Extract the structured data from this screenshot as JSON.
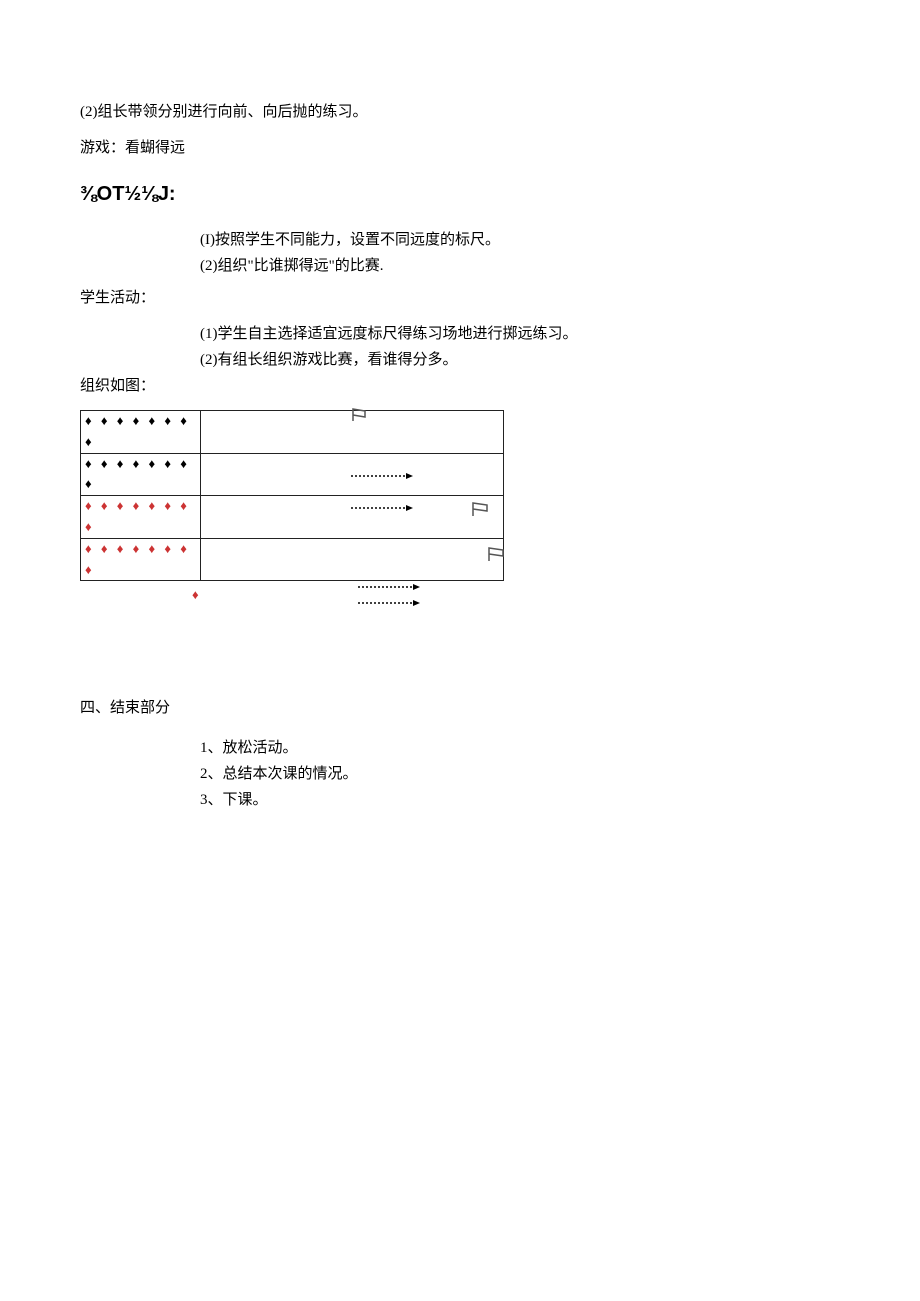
{
  "p1": "(2)组长带领分别进行向前、向后抛的练习。",
  "p2": "游戏：看蝴得远",
  "heading": "⅜OT½⅛J:",
  "teacher1": "(I)按照学生不同能力，设置不同远度的标尺。",
  "teacher2": "(2)组织\"比谁掷得远\"的比赛.",
  "studentLabel": "学生活动：",
  "student1": "(1)学生自主选择适宜远度标尺得练习场地进行掷远练习。",
  "student2": "(2)有组长组织游戏比赛，看谁得分多。",
  "orgLabel": "组织如图：",
  "section4": "四、结束部分",
  "end1": "1、放松活动。",
  "end2": "2、总结本次课的情况。",
  "end3": "3、下课。"
}
